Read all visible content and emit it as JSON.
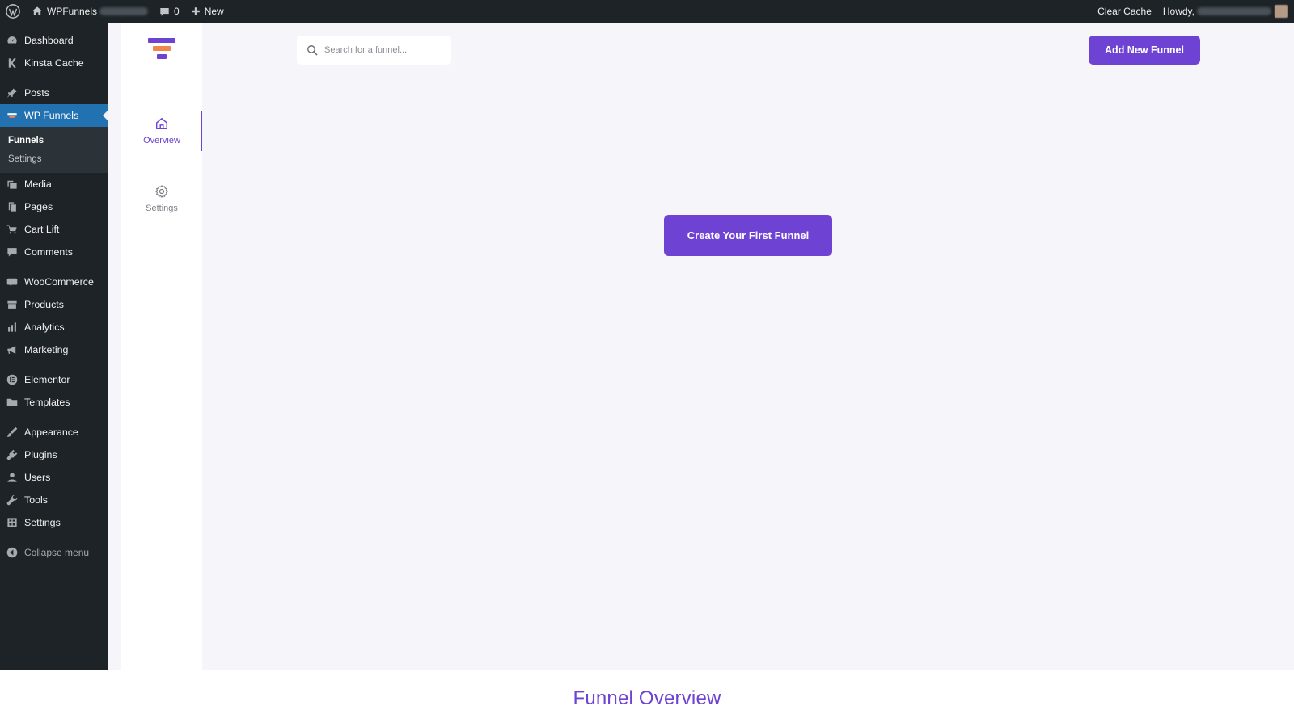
{
  "adminbar": {
    "site_name": "WPFunnels",
    "comments_count": "0",
    "new_label": "New",
    "clear_cache_label": "Clear Cache",
    "howdy_label": "Howdy,"
  },
  "wp_menu": {
    "items": [
      {
        "label": "Dashboard",
        "icon": "dashboard-icon"
      },
      {
        "label": "Kinsta Cache",
        "icon": "kinsta-icon"
      },
      {
        "label": "Posts",
        "icon": "pin-icon"
      },
      {
        "label": "WP Funnels",
        "icon": "wpfunnels-icon"
      },
      {
        "label": "Media",
        "icon": "media-icon"
      },
      {
        "label": "Pages",
        "icon": "pages-icon"
      },
      {
        "label": "Cart Lift",
        "icon": "cart-lift-icon"
      },
      {
        "label": "Comments",
        "icon": "comment-icon"
      },
      {
        "label": "WooCommerce",
        "icon": "woocommerce-icon"
      },
      {
        "label": "Products",
        "icon": "products-icon"
      },
      {
        "label": "Analytics",
        "icon": "analytics-icon"
      },
      {
        "label": "Marketing",
        "icon": "megaphone-icon"
      },
      {
        "label": "Elementor",
        "icon": "elementor-icon"
      },
      {
        "label": "Templates",
        "icon": "folder-icon"
      },
      {
        "label": "Appearance",
        "icon": "brush-icon"
      },
      {
        "label": "Plugins",
        "icon": "plug-icon"
      },
      {
        "label": "Users",
        "icon": "user-icon"
      },
      {
        "label": "Tools",
        "icon": "wrench-icon"
      },
      {
        "label": "Settings",
        "icon": "settings-icon"
      }
    ],
    "submenu": [
      {
        "label": "Funnels"
      },
      {
        "label": "Settings"
      }
    ],
    "collapse_label": "Collapse menu"
  },
  "plugin_nav": {
    "overview_label": "Overview",
    "settings_label": "Settings"
  },
  "search": {
    "placeholder": "Search for a funnel..."
  },
  "buttons": {
    "add_new_funnel": "Add New Funnel",
    "create_first_funnel": "Create Your First Funnel"
  },
  "caption": {
    "title": "Funnel Overview"
  },
  "colors": {
    "accent": "#6e42d3",
    "admin_dark": "#1d2327",
    "menu_active": "#2271b1",
    "content_bg": "#f6f5fa"
  }
}
